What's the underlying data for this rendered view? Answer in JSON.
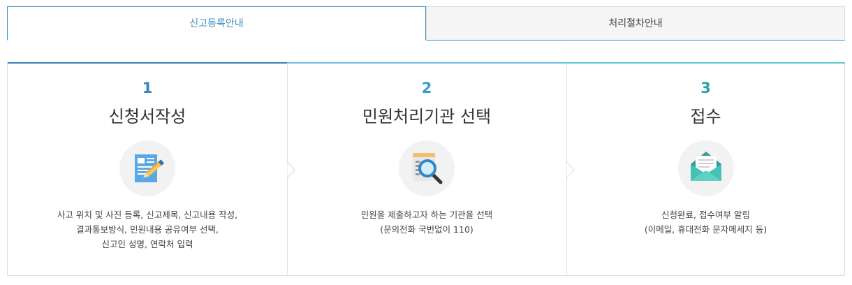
{
  "tabs": [
    {
      "label": "신고등록안내",
      "active": true
    },
    {
      "label": "처리절차안내",
      "active": false
    }
  ],
  "colors": {
    "accent": "#3a8fc4",
    "step1": "#3a7fc0",
    "step2": "#3a9ad0",
    "step3": "#2aa3a0"
  },
  "steps": [
    {
      "number": "1",
      "title": "신청서작성",
      "icon": "document-pencil-icon",
      "desc": [
        "사고 위치 및 사진 등록, 신고제목, 신고내용 작성,",
        "결과통보방식, 민원내용 공유여부 선택,",
        "신고인 성명, 연락처 입력"
      ]
    },
    {
      "number": "2",
      "title": "민원처리기관 선택",
      "icon": "magnifier-document-icon",
      "desc": [
        "민원을 제출하고자 하는 기관을 선택",
        "(문의전화 국번없이 110)"
      ]
    },
    {
      "number": "3",
      "title": "접수",
      "icon": "envelope-letter-icon",
      "desc": [
        "신청완료, 접수여부 알림",
        "(이메일, 휴대전화 문자메세지 등)"
      ]
    }
  ]
}
